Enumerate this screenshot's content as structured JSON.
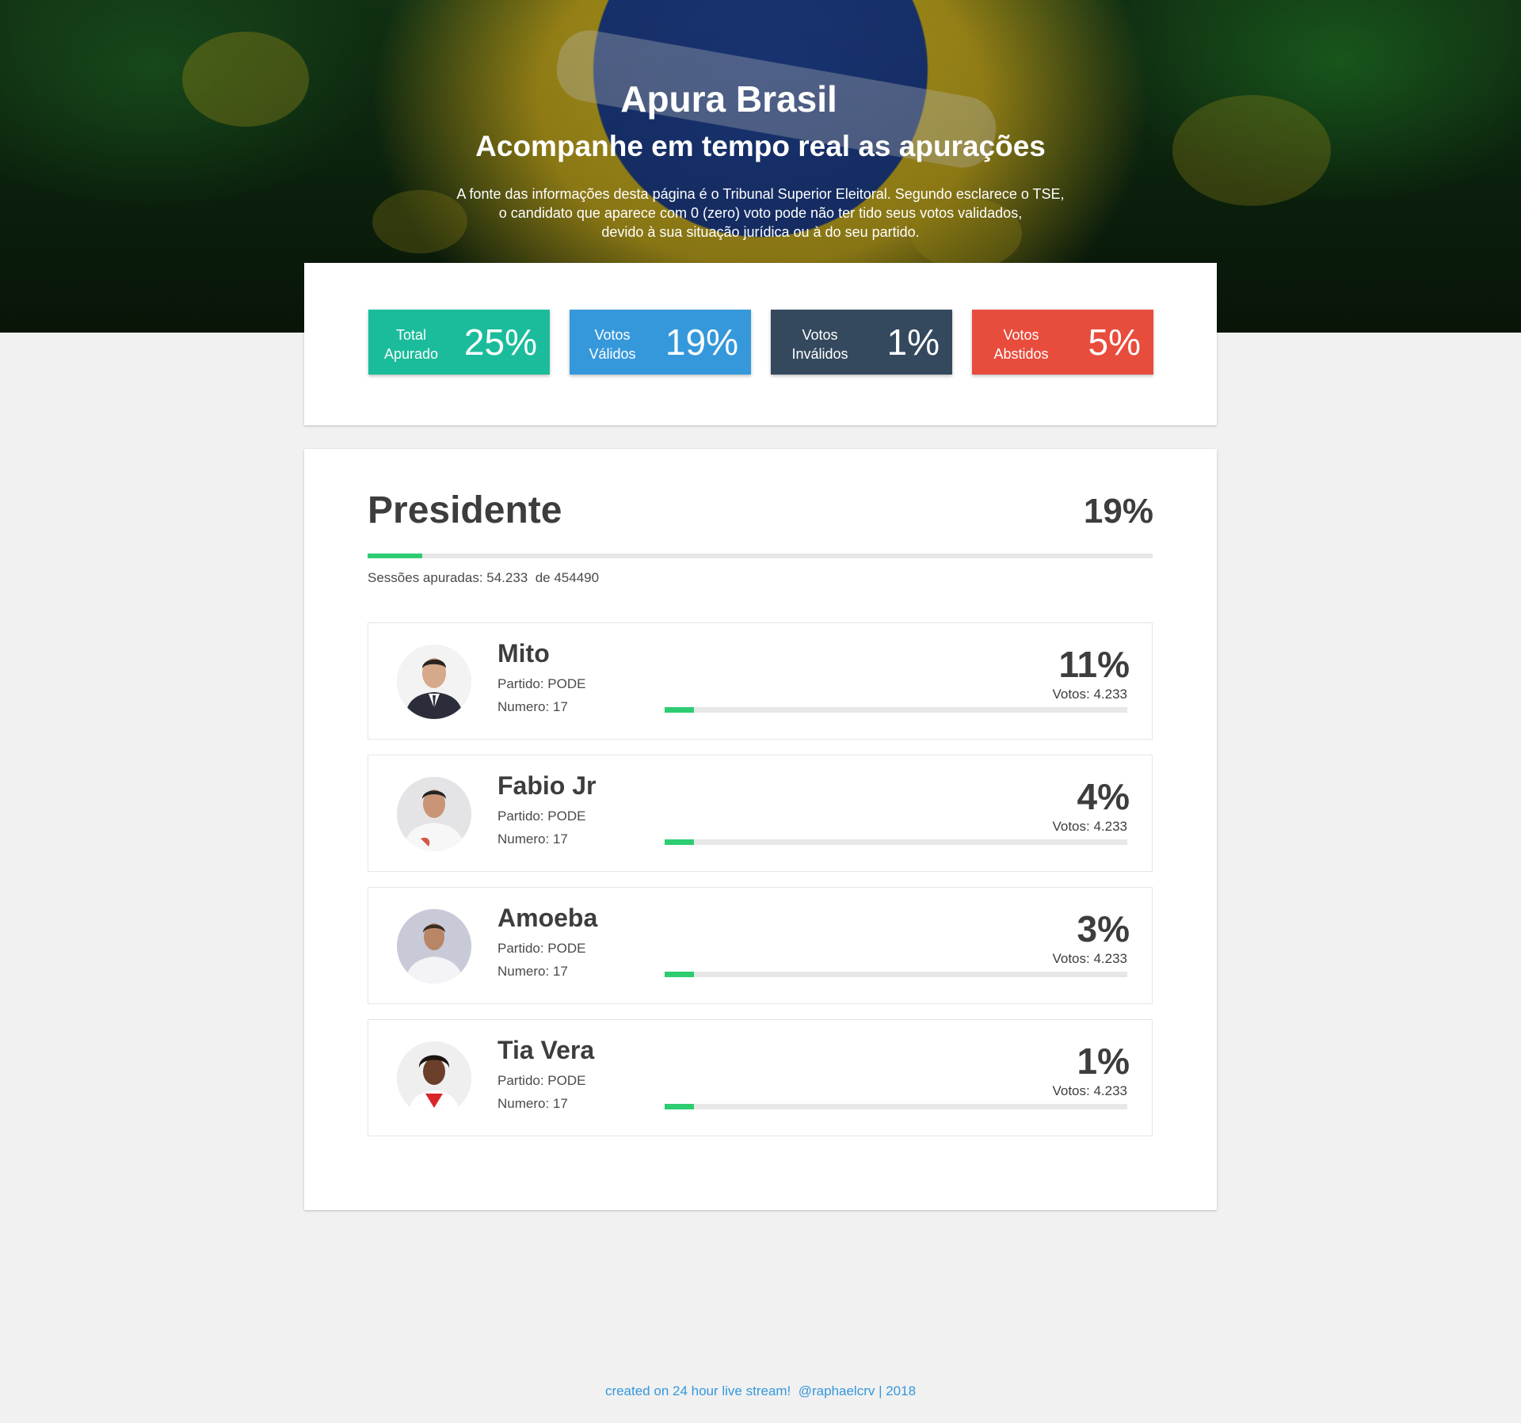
{
  "header": {
    "title": "Apura Brasil",
    "subtitle": "Acompanhe em tempo real as apurações",
    "description_lines": [
      "A fonte das informações desta página é o Tribunal Superior Eleitoral. Segundo esclarece o TSE,",
      "o candidato que aparece com 0 (zero) voto pode não ter tido seus votos validados,",
      "devido à sua situação jurídica ou à do seu partido."
    ]
  },
  "stats": {
    "total": {
      "label_line1": "Total",
      "label_line2": "Apurado",
      "value": "25%",
      "color": "#1bbc9b"
    },
    "validos": {
      "label_line1": "Votos",
      "label_line2": "Válidos",
      "value": "19%",
      "color": "#3598db"
    },
    "invalidos": {
      "label_line1": "Votos",
      "label_line2": "Inválidos",
      "value": "1%",
      "color": "#34495e"
    },
    "abstidos": {
      "label_line1": "Votos",
      "label_line2": "Abstidos",
      "value": "5%",
      "color": "#e84c3d"
    }
  },
  "results": {
    "title": "Presidente",
    "percent": "19%",
    "progress_fraction": 0.07,
    "sessions_label": "Sessões apuradas: 54.233  de 454490",
    "candidates": [
      {
        "name": "Mito",
        "party": "Partido: PODE",
        "number": "Numero: 17",
        "percent": "11%",
        "votes": "Votos: 4.233",
        "progress_fraction": 0.064
      },
      {
        "name": "Fabio Jr",
        "party": "Partido: PODE",
        "number": "Numero: 17",
        "percent": "4%",
        "votes": "Votos: 4.233",
        "progress_fraction": 0.064
      },
      {
        "name": "Amoeba",
        "party": "Partido: PODE",
        "number": "Numero: 17",
        "percent": "3%",
        "votes": "Votos: 4.233",
        "progress_fraction": 0.064
      },
      {
        "name": "Tia Vera",
        "party": "Partido: PODE",
        "number": "Numero: 17",
        "percent": "1%",
        "votes": "Votos: 4.233",
        "progress_fraction": 0.064
      }
    ]
  },
  "footer": {
    "text": "created on 24 hour live stream!  @raphaelcrv | 2018"
  },
  "colors": {
    "accent_green": "#2ecc71",
    "footer_link": "#3598db"
  }
}
